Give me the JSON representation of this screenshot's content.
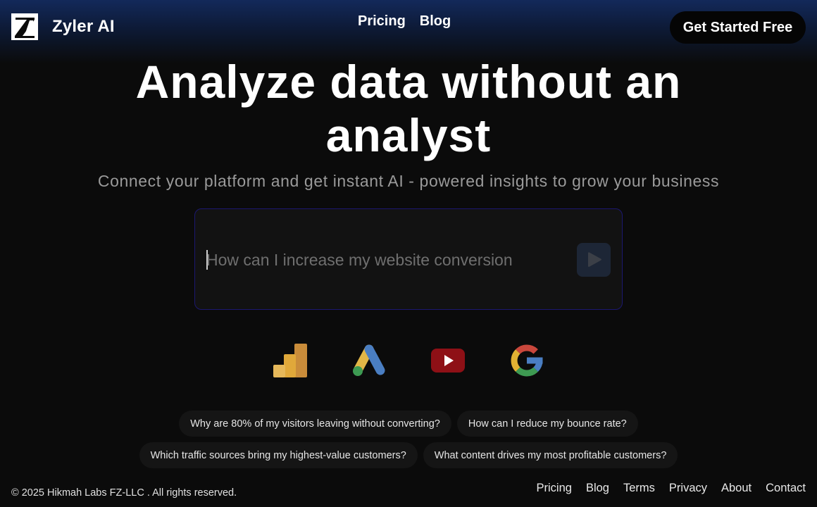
{
  "header": {
    "brand": "Zyler AI",
    "logo_icon": "zyler-z-logo",
    "nav": [
      {
        "label": "Pricing"
      },
      {
        "label": "Blog"
      }
    ],
    "cta_label": "Get Started Free"
  },
  "hero": {
    "title": "Analyze data without an analyst",
    "subtitle": "Connect your platform and get instant AI - powered insights to grow your business"
  },
  "prompt": {
    "placeholder": "How can I increase my website conversion",
    "value": "",
    "send_icon": "play-icon"
  },
  "integrations": [
    {
      "icon": "google-analytics-icon",
      "color": "#e0a83a"
    },
    {
      "icon": "google-ads-icon",
      "color": "#4a7ec2"
    },
    {
      "icon": "youtube-icon",
      "color": "#8e1016"
    },
    {
      "icon": "google-icon",
      "color": "#4285f4"
    }
  ],
  "suggestions": [
    [
      "Why are 80% of my visitors leaving without converting?",
      "How can I reduce my bounce rate?"
    ],
    [
      "Which traffic sources bring my highest-value customers?",
      "What content drives my most profitable customers?"
    ]
  ],
  "footer": {
    "copyright": "© 2025 Hikmah Labs FZ-LLC . All rights reserved.",
    "links": [
      {
        "label": "Pricing"
      },
      {
        "label": "Blog"
      },
      {
        "label": "Terms"
      },
      {
        "label": "Privacy"
      },
      {
        "label": "About"
      },
      {
        "label": "Contact"
      }
    ]
  },
  "colors": {
    "background": "#0b0b0b",
    "header_glow": "#13295a",
    "prompt_border": "#1c1870",
    "chip_bg": "#151515"
  }
}
